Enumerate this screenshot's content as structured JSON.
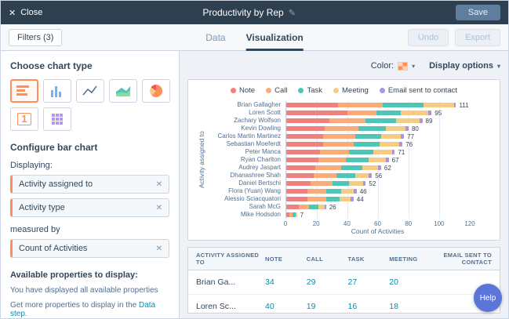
{
  "topbar": {
    "close_label": "Close",
    "title": "Productivity by Rep",
    "save_label": "Save"
  },
  "toolbar": {
    "filters_label": "Filters (3)",
    "tabs": [
      {
        "label": "Data"
      },
      {
        "label": "Visualization"
      }
    ],
    "undo_label": "Undo",
    "export_label": "Export"
  },
  "sidebar": {
    "choose_heading": "Choose chart type",
    "configure_heading": "Configure bar chart",
    "displaying_label": "Displaying:",
    "displaying_fields": [
      "Activity assigned to",
      "Activity type"
    ],
    "measured_by_label": "measured by",
    "measure_field": "Count of Activities",
    "available_heading": "Available properties to display:",
    "available_note": "You have displayed all available properties",
    "more_text_prefix": "Get more properties to display in the ",
    "more_link": "Data step",
    "more_text_suffix": "."
  },
  "chart_controls": {
    "color_label": "Color:",
    "display_options_label": "Display options"
  },
  "colors": {
    "accent": "#ff8f59",
    "link": "#0091ae",
    "navbar": "#2e3f50",
    "help_button": "#5b76d8"
  },
  "chart_data": {
    "type": "bar",
    "orientation": "horizontal",
    "stacked": true,
    "xlabel": "Count of Activities",
    "ylabel": "Activity assigned to",
    "xlim": [
      0,
      120
    ],
    "xticks": [
      0,
      20,
      40,
      60,
      80,
      100,
      120
    ],
    "grid": true,
    "legend_position": "top",
    "legend": [
      {
        "name": "Note",
        "color": "#f0807d"
      },
      {
        "name": "Call",
        "color": "#fbab77"
      },
      {
        "name": "Task",
        "color": "#4ec6b7"
      },
      {
        "name": "Meeting",
        "color": "#f5cc84"
      },
      {
        "name": "Email sent to contact",
        "color": "#ab93e0"
      }
    ],
    "categories": [
      "Brian Gallagher",
      "Loren Scott",
      "Zachary Wolfson",
      "Kevin Dowling",
      "Carlos Martin Martinez",
      "Sebastian Moeferdt",
      "Peter Manca",
      "Ryan Charlton",
      "Audrey Jaspart",
      "Dhanashree Shah",
      "Daniel Bertschi",
      "Flora (Yuan) Wang",
      "Alessio Sciacquatori",
      "Sarah McG",
      "Mike Hodsdon"
    ],
    "series": [
      {
        "name": "Note",
        "values": [
          34,
          40,
          28,
          25,
          24,
          24,
          22,
          21,
          19,
          18,
          16,
          14,
          14,
          8,
          2
        ]
      },
      {
        "name": "Call",
        "values": [
          29,
          19,
          24,
          22,
          21,
          20,
          19,
          18,
          17,
          15,
          14,
          12,
          12,
          7,
          2
        ]
      },
      {
        "name": "Task",
        "values": [
          27,
          16,
          20,
          18,
          17,
          17,
          16,
          15,
          14,
          12,
          11,
          10,
          9,
          6,
          2
        ]
      },
      {
        "name": "Meeting",
        "values": [
          20,
          18,
          15,
          13,
          13,
          13,
          12,
          11,
          10,
          9,
          9,
          8,
          7,
          4,
          1
        ]
      },
      {
        "name": "Email sent to contact",
        "values": [
          1,
          2,
          2,
          2,
          2,
          2,
          2,
          2,
          2,
          2,
          2,
          2,
          2,
          1,
          0
        ]
      }
    ],
    "totals": [
      111,
      95,
      89,
      80,
      77,
      76,
      71,
      67,
      62,
      56,
      52,
      46,
      44,
      26,
      7
    ]
  },
  "table": {
    "headers": [
      "ACTIVITY ASSIGNED TO",
      "NOTE",
      "CALL",
      "TASK",
      "MEETING",
      "EMAIL SENT TO CONTACT"
    ],
    "rows": [
      {
        "name": "Brian Ga...",
        "values": [
          "34",
          "29",
          "27",
          "20",
          ""
        ]
      },
      {
        "name": "Loren Sc...",
        "values": [
          "40",
          "19",
          "16",
          "18",
          ""
        ]
      }
    ]
  },
  "help_label": "Help"
}
